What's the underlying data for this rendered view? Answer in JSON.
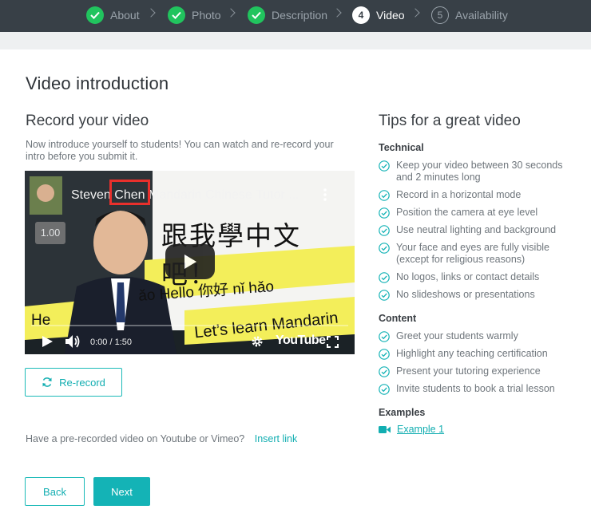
{
  "stepper": {
    "steps": [
      {
        "number": "1",
        "label": "About",
        "state": "done"
      },
      {
        "number": "2",
        "label": "Photo",
        "state": "done"
      },
      {
        "number": "3",
        "label": "Description",
        "state": "done"
      },
      {
        "number": "4",
        "label": "Video",
        "state": "current"
      },
      {
        "number": "5",
        "label": "Availability",
        "state": "future"
      }
    ]
  },
  "page": {
    "title": "Video introduction",
    "record_heading": "Record your video",
    "intro_text": "Now introduce yourself to students! You can watch and re-record your intro before you submit it.",
    "rerecord_label": "Re-record",
    "prerecorded_text": "Have a pre-recorded video on Youtube or Vimeo?",
    "insert_link_label": "Insert link",
    "back_label": "Back",
    "next_label": "Next"
  },
  "video": {
    "title_prefix": "Steven ",
    "title_highlight": "Chen",
    "title_suffix": " Mandarin Chinese Tutor ...",
    "speed": "1.00",
    "time": "0:00 / 1:50",
    "brand": "YouTube",
    "caption_chinese": "跟我學中文吧！",
    "caption_hello": "ǎo Hello 你好 nǐ hǎo",
    "caption_lets": "Let’s learn Mandarin",
    "caption_he": "He",
    "highlight_color": "#e8302c"
  },
  "tips": {
    "heading": "Tips for a great video",
    "technical_title": "Technical",
    "technical": [
      "Keep your video between 30 seconds and 2 minutes long",
      "Record in a horizontal mode",
      "Position the camera at eye level",
      "Use neutral lighting and background",
      "Your face and eyes are fully visible (except for religious reasons)",
      "No logos, links or contact details",
      "No slideshows or presentations"
    ],
    "content_title": "Content",
    "content": [
      "Greet your students warmly",
      "Highlight any teaching certification",
      "Present your tutoring experience",
      "Invite students to book a trial lesson"
    ],
    "examples_title": "Examples",
    "example_link": "Example 1"
  },
  "colors": {
    "accent": "#14b3b6",
    "stepper_bg": "#384047",
    "done_green": "#21c45e"
  }
}
